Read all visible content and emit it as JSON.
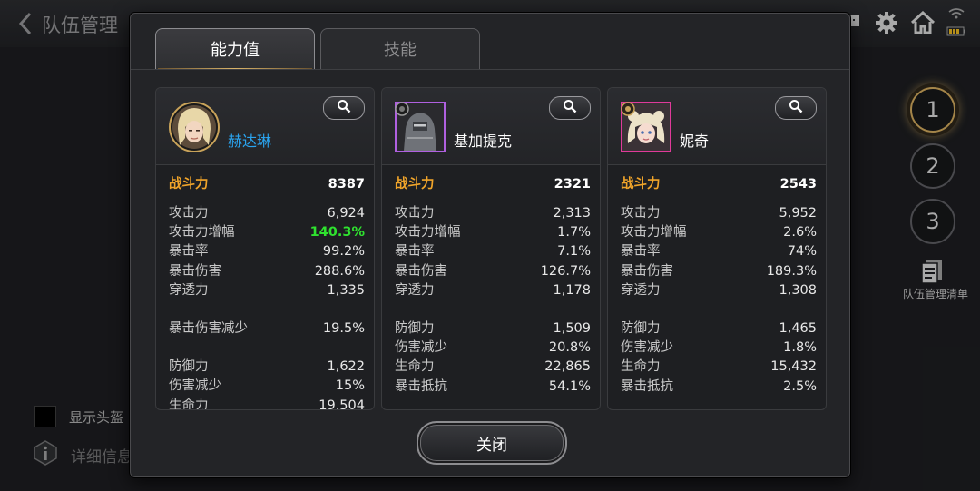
{
  "background": {
    "title": "队伍管理",
    "team_slots": [
      "1",
      "2",
      "3"
    ],
    "list_label": "队伍管理清单",
    "show_helmet_label": "显示头盔",
    "details_label": "详细信息"
  },
  "modal": {
    "tabs": [
      {
        "label": "能力值",
        "active": true
      },
      {
        "label": "技能",
        "active": false
      }
    ],
    "close_label": "关闭",
    "characters": [
      {
        "name": "赫达琳",
        "name_color": "#2aa4ef",
        "power_label": "战斗力",
        "power": "8387",
        "stats": [
          {
            "label": "攻击力",
            "value": "6,924"
          },
          {
            "label": "攻击力增幅",
            "value": "140.3%",
            "highlight": true
          },
          {
            "label": "暴击率",
            "value": "99.2%"
          },
          {
            "label": "暴击伤害",
            "value": "288.6%"
          },
          {
            "label": "穿透力",
            "value": "1,335"
          }
        ],
        "stats2": [
          {
            "label": "暴击伤害减少",
            "value": "19.5%"
          }
        ],
        "stats3": [
          {
            "label": "防御力",
            "value": "1,622"
          },
          {
            "label": "伤害减少",
            "value": "15%"
          },
          {
            "label": "生命力",
            "value": "19,504"
          }
        ]
      },
      {
        "name": "基加提克",
        "name_color": "#ffffff",
        "power_label": "战斗力",
        "power": "2321",
        "stats": [
          {
            "label": "攻击力",
            "value": "2,313"
          },
          {
            "label": "攻击力增幅",
            "value": "1.7%"
          },
          {
            "label": "暴击率",
            "value": "7.1%"
          },
          {
            "label": "暴击伤害",
            "value": "126.7%"
          },
          {
            "label": "穿透力",
            "value": "1,178"
          }
        ],
        "stats2": [
          {
            "label": "防御力",
            "value": "1,509"
          },
          {
            "label": "伤害减少",
            "value": "20.8%"
          },
          {
            "label": "生命力",
            "value": "22,865"
          },
          {
            "label": "暴击抵抗",
            "value": "54.1%"
          }
        ]
      },
      {
        "name": "妮奇",
        "name_color": "#ffffff",
        "power_label": "战斗力",
        "power": "2543",
        "stats": [
          {
            "label": "攻击力",
            "value": "5,952"
          },
          {
            "label": "攻击力增幅",
            "value": "2.6%"
          },
          {
            "label": "暴击率",
            "value": "74%"
          },
          {
            "label": "暴击伤害",
            "value": "189.3%"
          },
          {
            "label": "穿透力",
            "value": "1,308"
          }
        ],
        "stats2": [
          {
            "label": "防御力",
            "value": "1,465"
          },
          {
            "label": "伤害减少",
            "value": "1.8%"
          },
          {
            "label": "生命力",
            "value": "15,432"
          },
          {
            "label": "暴击抵抗",
            "value": "2.5%"
          }
        ]
      }
    ]
  },
  "icons": {
    "back": "back-arrow-icon",
    "chat": "chat-icon",
    "settings": "gear-icon",
    "home": "home-icon",
    "wifi": "wifi-icon",
    "battery": "battery-icon",
    "search": "search-icon",
    "list": "list-document-icon",
    "info": "info-icon"
  },
  "colors": {
    "accent_gold": "#c9a35a",
    "power_orange": "#f0a42a",
    "highlight_green": "#2fe22f",
    "name_blue": "#2aa4ef"
  }
}
